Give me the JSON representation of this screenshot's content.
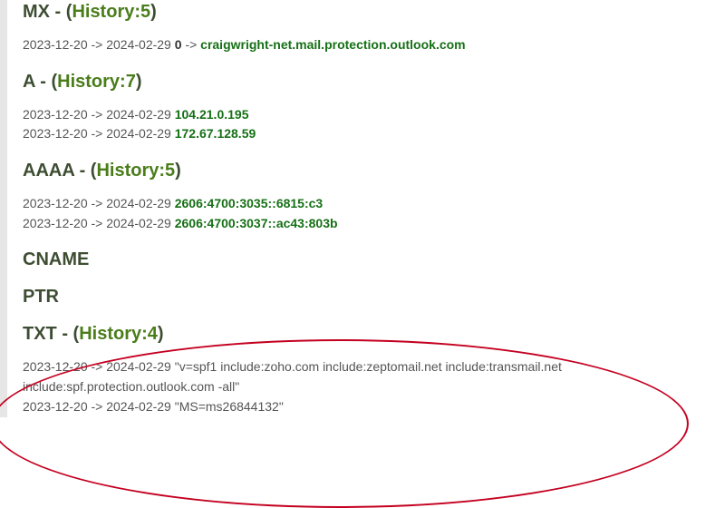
{
  "sections": {
    "mx": {
      "type": "MX",
      "history_label": "History",
      "history_count": "5",
      "entries": [
        {
          "range": "2023-12-20 -> 2024-02-29",
          "prio": "0",
          "sep": "->",
          "value": "craigwright-net.mail.protection.outlook.com"
        }
      ]
    },
    "a": {
      "type": "A",
      "history_label": "History",
      "history_count": "7",
      "entries": [
        {
          "range": "2023-12-20 -> 2024-02-29",
          "value": "104.21.0.195"
        },
        {
          "range": "2023-12-20 -> 2024-02-29",
          "value": "172.67.128.59"
        }
      ]
    },
    "aaaa": {
      "type": "AAAA",
      "history_label": "History",
      "history_count": "5",
      "entries": [
        {
          "range": "2023-12-20 -> 2024-02-29",
          "value": "2606:4700:3035::6815:c3"
        },
        {
          "range": "2023-12-20 -> 2024-02-29",
          "value": "2606:4700:3037::ac43:803b"
        }
      ]
    },
    "cname": {
      "type": "CNAME"
    },
    "ptr": {
      "type": "PTR"
    },
    "txt": {
      "type": "TXT",
      "history_label": "History",
      "history_count": "4",
      "entries": [
        {
          "range": "2023-12-20 -> 2024-02-29",
          "value": "\"v=spf1 include:zoho.com include:zeptomail.net include:transmail.net include:spf.protection.outlook.com -all\""
        },
        {
          "range": "2023-12-20 -> 2024-02-29",
          "value": "\"MS=ms26844132\""
        }
      ]
    }
  }
}
